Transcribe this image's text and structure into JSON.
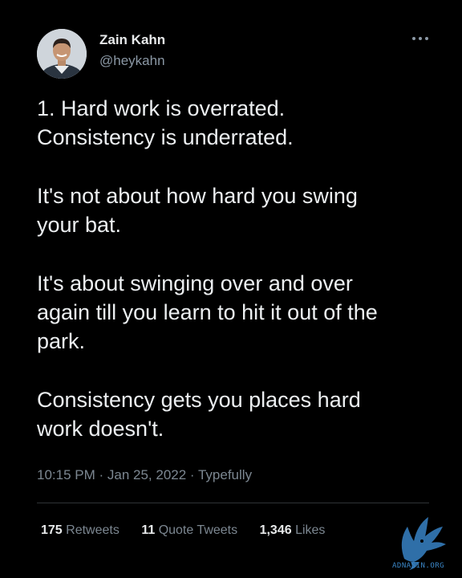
{
  "author": {
    "display_name": "Zain Kahn",
    "handle": "@heykahn",
    "avatar_icon": "person-avatar"
  },
  "tweet": {
    "paragraphs": [
      "1. Hard work is overrated.\nConsistency is underrated.",
      "It's not about how hard you swing\nyour bat.",
      "It's about swinging over and over\nagain till you learn to hit it out of the\npark.",
      "Consistency gets you places hard\nwork doesn't."
    ],
    "timestamp": "10:15 PM · Jan 25, 2022 · Typefully"
  },
  "stats": {
    "retweets_count": "175",
    "retweets_label": "Retweets",
    "quote_tweets_count": "11",
    "quote_tweets_label": "Quote Tweets",
    "likes_count": "1,346",
    "likes_label": "Likes"
  },
  "more_icon": "more-horizontal-icon",
  "watermark": {
    "text": "ADNASIN.ORG",
    "icon": "eagle-logo"
  },
  "colors": {
    "background": "#000000",
    "primary_text": "#e7e9ea",
    "secondary_text": "#7c8791",
    "divider": "#2f3336",
    "watermark": "#3b87c8"
  }
}
